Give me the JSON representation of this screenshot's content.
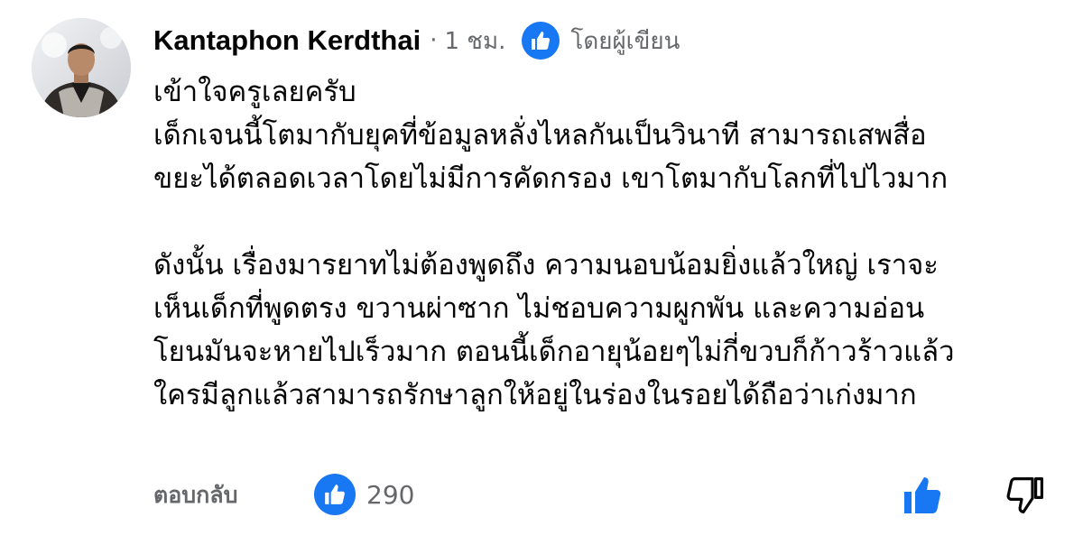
{
  "comment": {
    "author": "Kantaphon Kerdthai",
    "separator": "·",
    "time": "1 ชม.",
    "author_badge": {
      "icon": "thumbs-up-icon",
      "label": "โดยผู้เขียน"
    },
    "paragraphs": [
      {
        "lines": [
          "เข้าใจครูเลยครับ",
          "เด็กเจนนี้โตมากับยุคที่ข้อมูลหลั่งไหลกันเป็นวินาที สามารถเสพสื่อ",
          "ขยะได้ตลอดเวลาโดยไม่มีการคัดกรอง เขาโตมากับโลกที่ไปไวมาก"
        ]
      },
      {
        "lines": [
          "ดังนั้น เรื่องมารยาทไม่ต้องพูดถึง ความนอบน้อมยิ่งแล้วใหญ่ เราจะ",
          "เห็นเด็กที่พูดตรง ขวานผ่าซาก ไม่ชอบความผูกพัน และความอ่อน",
          "โยนมันจะหายไปเร็วมาก ตอนนี้เด็กอายุน้อยๆไม่กี่ขวบก็ก้าวร้าวแล้ว",
          "ใครมีลูกแล้วสามารถรักษาลูกให้อยู่ในร่องในรอยได้ถือว่าเก่งมาก"
        ]
      }
    ]
  },
  "footer": {
    "reply_label": "ตอบกลับ",
    "reaction_icon": "thumbs-up-icon",
    "reaction_count": "290",
    "like_icon": "thumbs-up-icon",
    "dislike_icon": "thumbs-down-icon"
  },
  "colors": {
    "accent": "#1877f2",
    "secondary_text": "#65676b",
    "primary_text": "#050505"
  }
}
